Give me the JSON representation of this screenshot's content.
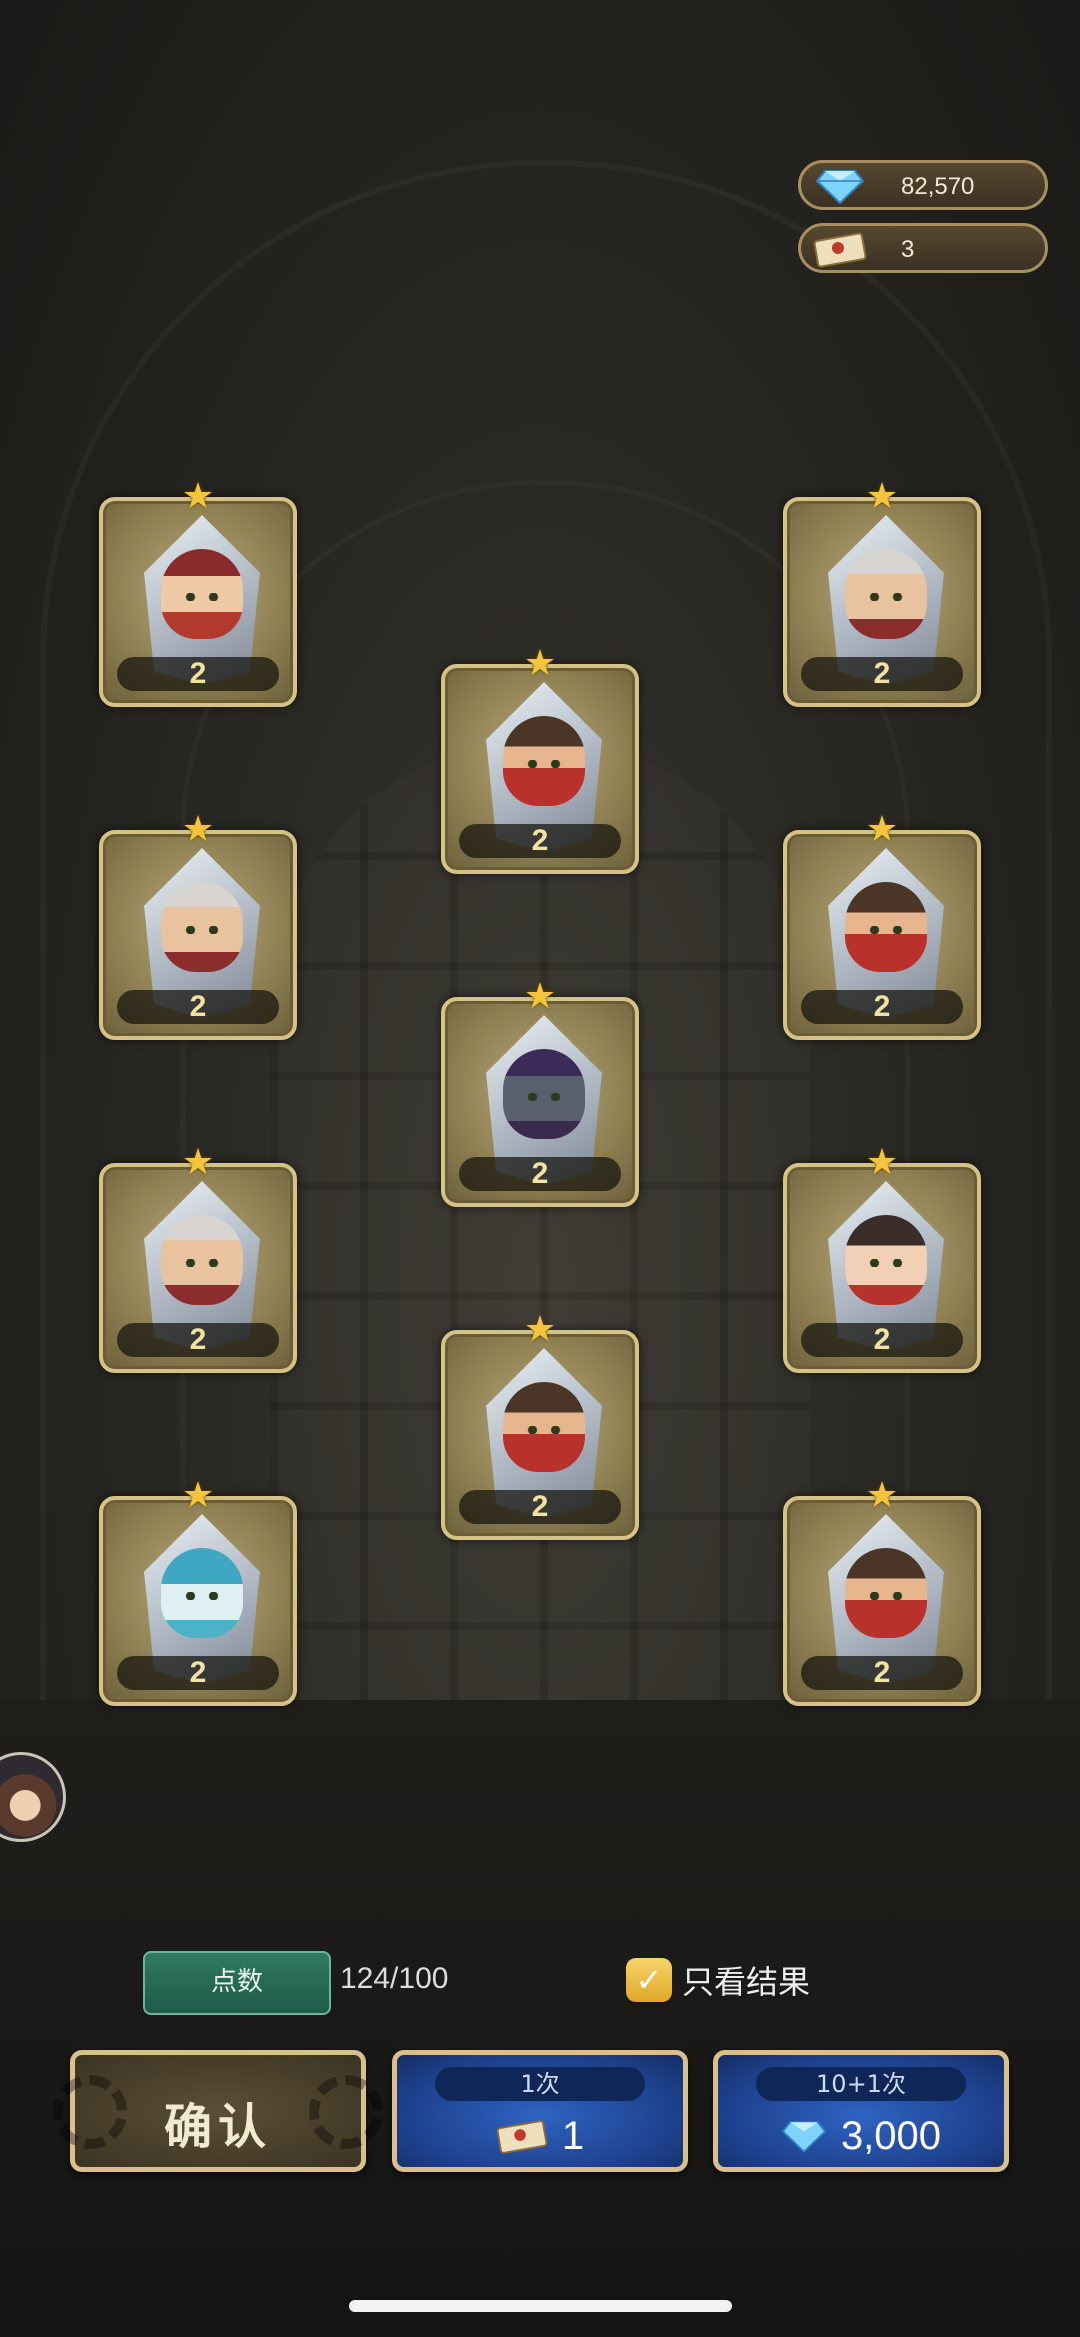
{
  "currency": {
    "gems": "82,570",
    "tickets": "3"
  },
  "heroes": [
    {
      "level": "2",
      "portrait": "f-red"
    },
    {
      "level": "2",
      "portrait": "f-pale"
    },
    {
      "level": "2",
      "portrait": "f-beard"
    },
    {
      "level": "2",
      "portrait": "f-pale"
    },
    {
      "level": "2",
      "portrait": "f-beard"
    },
    {
      "level": "2",
      "portrait": "f-dark"
    },
    {
      "level": "2",
      "portrait": "f-pale"
    },
    {
      "level": "2",
      "portrait": "f-pirate"
    },
    {
      "level": "2",
      "portrait": "f-beard"
    },
    {
      "level": "2",
      "portrait": "f-blue"
    },
    {
      "level": "2",
      "portrait": "f-beard"
    }
  ],
  "points": {
    "label": "点数",
    "value": "124/100"
  },
  "result_toggle": {
    "label": "只看结果",
    "checked": true
  },
  "buttons": {
    "confirm": "确认",
    "single": {
      "label": "1次",
      "cost": "1",
      "currency_icon": "ticket-icon"
    },
    "multi": {
      "label": "10+1次",
      "cost": "3,000",
      "currency_icon": "gem-icon"
    }
  },
  "colors": {
    "gold_border": "#d5c386",
    "blue_button": "#1d3f8a",
    "points_green": "#2f7a63"
  }
}
